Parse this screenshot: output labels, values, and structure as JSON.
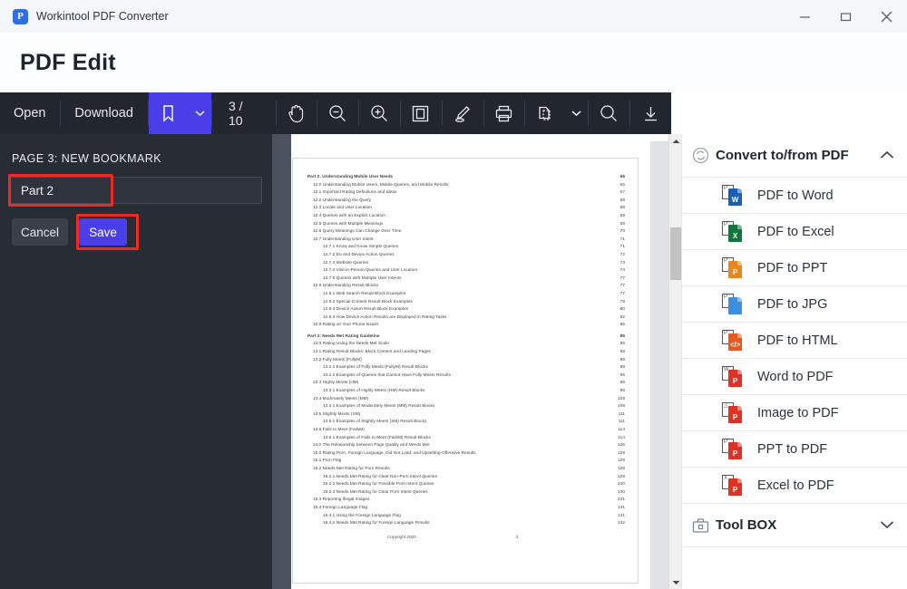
{
  "window": {
    "app_title": "Workintool PDF Converter",
    "logo_letter": "P",
    "minimize": "minimize-button",
    "maximize": "maximize-button",
    "close": "close-button"
  },
  "page_heading": {
    "title": "PDF Edit"
  },
  "toolbar": {
    "open_label": "Open",
    "download_label": "Download",
    "bookmark_icon": "bookmark-icon",
    "bookmark_caret": "chevron-down-icon",
    "page_indicator": "3 / 10",
    "tools": [
      {
        "name": "hand-tool-icon"
      },
      {
        "name": "zoom-out-icon"
      },
      {
        "name": "zoom-in-icon"
      },
      {
        "name": "page-layout-icon"
      },
      {
        "name": "highlight-pen-icon"
      },
      {
        "name": "print-icon"
      },
      {
        "name": "extract-pages-icon"
      },
      {
        "name": "chevron-down-icon"
      },
      {
        "name": "search-icon"
      },
      {
        "name": "save-download-icon"
      }
    ]
  },
  "sidebar": {
    "section_label": "PAGE 3: NEW BOOKMARK",
    "input_value": "Part 2",
    "input_placeholder": "",
    "cancel_label": "Cancel",
    "save_label": "Save",
    "annotation_color": "#ee2b23",
    "accent_color": "#4a3ee8"
  },
  "document": {
    "footer_copyright": "Copyright 2020",
    "footer_page": "3",
    "toc": [
      {
        "level": 0,
        "text": "Part 2: Understanding Mobile User Needs",
        "page": "66"
      },
      {
        "level": 1,
        "text": "12.0 Understanding Mobile Users, Mobile Queries, and Mobile Results",
        "page": "66"
      },
      {
        "level": 1,
        "text": "12.1 Important Rating Definitions and Ideas",
        "page": "67"
      },
      {
        "level": 1,
        "text": "12.2 Understanding the Query",
        "page": "68"
      },
      {
        "level": 1,
        "text": "12.3 Locale and User Location",
        "page": "68"
      },
      {
        "level": 1,
        "text": "12.4 Queries with an Explicit Location",
        "page": "69"
      },
      {
        "level": 1,
        "text": "12.5 Queries with Multiple Meanings",
        "page": "69"
      },
      {
        "level": 1,
        "text": "12.6 Query Meanings Can Change Over Time",
        "page": "70"
      },
      {
        "level": 1,
        "text": "12.7 Understanding User Intent",
        "page": "71"
      },
      {
        "level": 2,
        "text": "12.7.1 Know and Know Simple Queries",
        "page": "71"
      },
      {
        "level": 2,
        "text": "12.7.2 Do and Device Action Queries",
        "page": "72"
      },
      {
        "level": 2,
        "text": "12.7.3 Website Queries",
        "page": "73"
      },
      {
        "level": 2,
        "text": "12.7.4 Visit-in-Person Queries and User Location",
        "page": "74"
      },
      {
        "level": 2,
        "text": "12.7.5 Queries with Multiple User Intents",
        "page": "77"
      },
      {
        "level": 1,
        "text": "12.8 Understanding Result Blocks",
        "page": "77"
      },
      {
        "level": 2,
        "text": "12.8.1 Web Search Result Block Examples",
        "page": "77"
      },
      {
        "level": 2,
        "text": "12.8.2 Special Content Result Block Examples",
        "page": "78"
      },
      {
        "level": 2,
        "text": "12.8.3 Device Action Result Block Examples",
        "page": "80"
      },
      {
        "level": 2,
        "text": "12.8.4 How Device Action Results are Displayed in Rating Tasks",
        "page": "82"
      },
      {
        "level": 1,
        "text": "12.9 Rating on Your Phone Issues",
        "page": "85"
      },
      {
        "level": 0,
        "text": "Part 3: Needs Met Rating Guideline",
        "page": "86"
      },
      {
        "level": 1,
        "text": "13.0 Rating Using the Needs Met Scale",
        "page": "86"
      },
      {
        "level": 1,
        "text": "13.1 Rating Result Blocks: Block Content and Landing Pages",
        "page": "88"
      },
      {
        "level": 1,
        "text": "13.2 Fully Meets (FullyM)",
        "page": "89"
      },
      {
        "level": 2,
        "text": "13.2.1 Examples of Fully Meets (FullyM) Result Blocks",
        "page": "89"
      },
      {
        "level": 2,
        "text": "13.2.2 Examples of Queries that Cannot Have Fully Meets Results",
        "page": "96"
      },
      {
        "level": 1,
        "text": "13.3 Highly Meets (HM)",
        "page": "99"
      },
      {
        "level": 2,
        "text": "13.3.1 Examples of Highly Meets (HM) Result Blocks",
        "page": "99"
      },
      {
        "level": 1,
        "text": "13.4 Moderately Meets (MM)",
        "page": "109"
      },
      {
        "level": 2,
        "text": "13.4.1 Examples of Moderately Meets (MM) Result Blocks",
        "page": "109"
      },
      {
        "level": 1,
        "text": "13.5 Slightly Meets (SM)",
        "page": "111"
      },
      {
        "level": 2,
        "text": "13.5.1 Examples of Slightly Meets (SM) Result Blocks",
        "page": "111"
      },
      {
        "level": 1,
        "text": "13.6 Fails to Meet (FailsM)",
        "page": "114"
      },
      {
        "level": 2,
        "text": "13.6.1 Examples of Fails to Meet (FailsM) Result Blocks",
        "page": "114"
      },
      {
        "level": 1,
        "text": "14.0 The Relationship between Page Quality and Needs Met",
        "page": "126"
      },
      {
        "level": 1,
        "text": "15.0 Rating Porn, Foreign Language, Did Not Load, and Upsetting-Offensive Results",
        "page": "129"
      },
      {
        "level": 1,
        "text": "15.1 Porn Flag",
        "page": "129"
      },
      {
        "level": 1,
        "text": "15.2 Needs Met Rating for Porn Results",
        "page": "129"
      },
      {
        "level": 2,
        "text": "15.2.1 Needs Met Rating for Clear Non-Porn Intent Queries",
        "page": "129"
      },
      {
        "level": 2,
        "text": "15.2.2 Needs Met Rating for Possible Porn Intent Queries",
        "page": "130"
      },
      {
        "level": 2,
        "text": "15.2.3 Needs Met Rating for Clear Porn Intent Queries",
        "page": "130"
      },
      {
        "level": 1,
        "text": "15.3 Reporting Illegal Images",
        "page": "131"
      },
      {
        "level": 1,
        "text": "15.4 Foreign Language Flag",
        "page": "131"
      },
      {
        "level": 2,
        "text": "15.4.1 Using the Foreign Language Flag",
        "page": "131"
      },
      {
        "level": 2,
        "text": "15.4.2 Needs Met Rating for Foreign Language Results",
        "page": "132"
      }
    ]
  },
  "right_panel": {
    "convert_section": {
      "title": "Convert to/from PDF",
      "icon": "convert-circle-icon",
      "chevron": "chevron-up-icon",
      "expanded": true,
      "items": [
        {
          "label": "PDF to Word",
          "icon": "pdf-to-word-icon",
          "badge": "W",
          "badge_color": "#1a5fb4",
          "src": "P"
        },
        {
          "label": "PDF to Excel",
          "icon": "pdf-to-excel-icon",
          "badge": "X",
          "badge_color": "#12763c",
          "src": "P"
        },
        {
          "label": "PDF to PPT",
          "icon": "pdf-to-ppt-icon",
          "badge": "P",
          "badge_color": "#e8871e",
          "src": "P"
        },
        {
          "label": "PDF to JPG",
          "icon": "pdf-to-jpg-icon",
          "badge": "",
          "badge_color": "#3f8fe0",
          "src": "P"
        },
        {
          "label": "PDF to HTML",
          "icon": "pdf-to-html-icon",
          "badge": "</>",
          "badge_color": "#e8581e",
          "src": "P"
        },
        {
          "label": "Word to PDF",
          "icon": "word-to-pdf-icon",
          "badge": "P",
          "badge_color": "#e03127",
          "src": "W"
        },
        {
          "label": "Image to PDF",
          "icon": "image-to-pdf-icon",
          "badge": "P",
          "badge_color": "#e03127",
          "src": "△"
        },
        {
          "label": "PPT to PDF",
          "icon": "ppt-to-pdf-icon",
          "badge": "P",
          "badge_color": "#e03127",
          "src": "P"
        },
        {
          "label": "Excel to PDF",
          "icon": "excel-to-pdf-icon",
          "badge": "P",
          "badge_color": "#e03127",
          "src": "X"
        }
      ]
    },
    "toolbox_section": {
      "title": "Tool BOX",
      "icon": "toolbox-icon",
      "chevron": "chevron-down-icon",
      "expanded": false
    }
  }
}
